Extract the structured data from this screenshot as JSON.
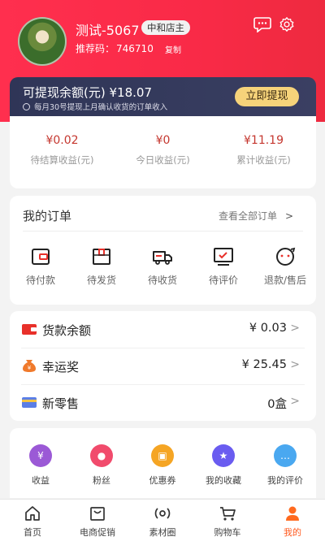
{
  "profile": {
    "username": "测试-5067",
    "role": "中和店主",
    "referral_label": "推荐码：",
    "referral_code": "746710",
    "copy_label": "复制"
  },
  "balance": {
    "title": "可提现余额(元)",
    "amount": "¥18.07",
    "tip": "每月30号提现上月确认收货的订单收入",
    "withdraw_label": "立即提现"
  },
  "earnings": [
    {
      "value": "¥0.02",
      "label": "待结算收益(元)"
    },
    {
      "value": "¥0",
      "label": "今日收益(元)"
    },
    {
      "value": "¥11.19",
      "label": "累计收益(元)"
    }
  ],
  "orders": {
    "title": "我的订单",
    "view_all": "查看全部订单",
    "items": [
      {
        "label": "待付款",
        "icon": "wallet-icon"
      },
      {
        "label": "待发货",
        "icon": "box-icon"
      },
      {
        "label": "待收货",
        "icon": "truck-icon"
      },
      {
        "label": "待评价",
        "icon": "review-icon"
      },
      {
        "label": "退款/售后",
        "icon": "refund-icon"
      }
    ]
  },
  "wallet": [
    {
      "label": "货款余额",
      "value": "¥ 0.03",
      "icon": "wallet-red-icon",
      "color": "#e8302a"
    },
    {
      "label": "幸运奖",
      "value": "¥ 25.45",
      "icon": "money-bag-icon",
      "color": "#f07a2c"
    },
    {
      "label": "新零售",
      "value": "0盒",
      "icon": "card-icon",
      "color": "#5b7fe6"
    }
  ],
  "tools": [
    {
      "label": "收益",
      "icon": "income-icon",
      "color": "#9b59d6"
    },
    {
      "label": "粉丝",
      "icon": "fans-icon",
      "color": "#f14b6c"
    },
    {
      "label": "优惠券",
      "icon": "coupon-icon",
      "color": "#f5a524"
    },
    {
      "label": "我的收藏",
      "icon": "favorite-icon",
      "color": "#6a5cf0"
    },
    {
      "label": "我的评价",
      "icon": "comment-icon",
      "color": "#4aa8f0"
    }
  ],
  "tabs": [
    {
      "label": "首页",
      "icon": "home-icon"
    },
    {
      "label": "电商促销",
      "icon": "shop-icon"
    },
    {
      "label": "素材圈",
      "icon": "material-icon"
    },
    {
      "label": "购物车",
      "icon": "cart-icon"
    },
    {
      "label": "我的",
      "icon": "profile-icon",
      "active": true
    }
  ],
  "accent_color": "#f92a47"
}
